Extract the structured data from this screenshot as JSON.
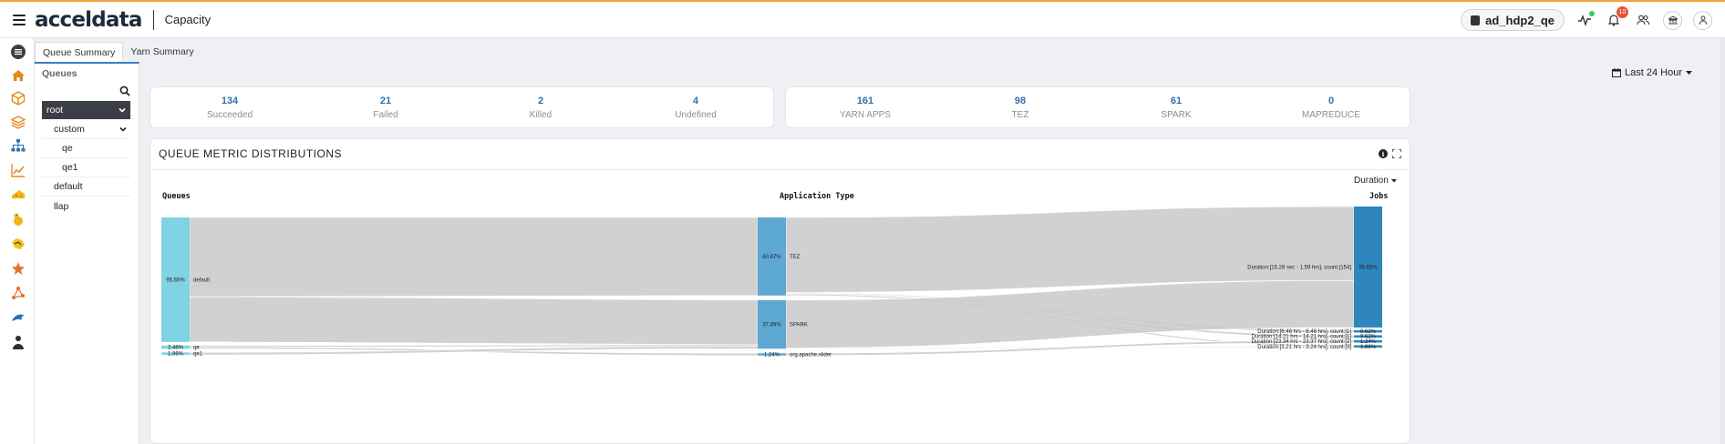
{
  "app": {
    "logo": "acceldata",
    "page_title": "Capacity"
  },
  "topbar": {
    "cluster": "ad_hdp2_qe",
    "notification_count": "10",
    "icons": [
      "pulse-icon",
      "bell-icon",
      "users-icon",
      "bank-icon",
      "user-icon"
    ]
  },
  "rail": {
    "items": [
      "menu-icon",
      "home-icon",
      "cube-icon",
      "layers-icon",
      "sitemap-icon",
      "line-chart-icon",
      "cheese-icon",
      "hadoop-icon",
      "hive-icon",
      "spark-icon",
      "network-icon",
      "dolphin-icon",
      "person-icon"
    ]
  },
  "tabs": [
    {
      "label": "Queue Summary",
      "active": true
    },
    {
      "label": "Yarn Summary",
      "active": false
    }
  ],
  "queues": {
    "title": "Queues",
    "root": "root",
    "items": [
      {
        "label": "custom",
        "expandable": true
      },
      {
        "label": "qe"
      },
      {
        "label": "qe1"
      },
      {
        "label": "default"
      },
      {
        "label": "llap"
      }
    ]
  },
  "date_filter": "Last 24 Hour",
  "stats_left": [
    {
      "value": "134",
      "label": "Succeeded"
    },
    {
      "value": "21",
      "label": "Failed"
    },
    {
      "value": "2",
      "label": "Killed"
    },
    {
      "value": "4",
      "label": "Undefined"
    }
  ],
  "stats_right": [
    {
      "value": "161",
      "label": "YARN APPS"
    },
    {
      "value": "98",
      "label": "TEZ"
    },
    {
      "value": "61",
      "label": "SPARK"
    },
    {
      "value": "0",
      "label": "MAPREDUCE"
    }
  ],
  "metric_panel": {
    "title": "QUEUE METRIC DISTRIBUTIONS",
    "metric_select": "Duration"
  },
  "chart_data": {
    "type": "sankey",
    "columns": [
      "Queues",
      "Application Type",
      "Jobs"
    ],
    "nodes": [
      {
        "name": "default",
        "column": 0,
        "percent": 95.65,
        "pct_label": "95.65%"
      },
      {
        "name": "qe",
        "column": 0,
        "percent": 2.48,
        "pct_label": "2.48%"
      },
      {
        "name": "qe1",
        "column": 0,
        "percent": 1.86,
        "pct_label": "1.86%"
      },
      {
        "name": "TEZ",
        "column": 1,
        "percent": 60.87,
        "pct_label": "60.87%"
      },
      {
        "name": "SPARK",
        "column": 1,
        "percent": 37.89,
        "pct_label": "37.89%"
      },
      {
        "name": "org.apache.slider",
        "column": 1,
        "percent": 1.24,
        "pct_label": "1.24%"
      },
      {
        "name": "Duration:[15.28 sec - 1.59 hrs], count:[154]",
        "column": 2,
        "percent": 95.65,
        "pct_label": "95.65%"
      },
      {
        "name": "Duration:[6.48 hrs - 6.48 hrs], count:[1]",
        "column": 2,
        "percent": 0.62,
        "pct_label": "0.62%"
      },
      {
        "name": "Duration:[14.21 hrs - 14.21 hrs], count:[1]",
        "column": 2,
        "percent": 0.62,
        "pct_label": "0.62%"
      },
      {
        "name": "Duration:[23.34 hrs - 23.37 hrs], count:[2]",
        "column": 2,
        "percent": 1.24,
        "pct_label": "1.24%"
      },
      {
        "name": "Duration:[3.21 hrs - 3.24 hrs], count:[3]",
        "column": 2,
        "percent": 1.86,
        "pct_label": "1.86%"
      }
    ],
    "links": [
      {
        "source": "default",
        "target": "TEZ",
        "value": 60.87
      },
      {
        "source": "default",
        "target": "SPARK",
        "value": 34.78
      },
      {
        "source": "qe",
        "target": "SPARK",
        "value": 1.24
      },
      {
        "source": "qe",
        "target": "org.apache.slider",
        "value": 1.24
      },
      {
        "source": "qe1",
        "target": "SPARK",
        "value": 1.86
      },
      {
        "source": "TEZ",
        "target": "Duration:[15.28 sec - 1.59 hrs], count:[154]",
        "value": 58.39
      },
      {
        "source": "TEZ",
        "target": "Duration:[6.48 hrs - 6.48 hrs], count:[1]",
        "value": 0.62
      },
      {
        "source": "TEZ",
        "target": "Duration:[14.21 hrs - 14.21 hrs], count:[1]",
        "value": 0.62
      },
      {
        "source": "TEZ",
        "target": "Duration:[3.21 hrs - 3.24 hrs], count:[3]",
        "value": 1.24
      },
      {
        "source": "SPARK",
        "target": "Duration:[15.28 sec - 1.59 hrs], count:[154]",
        "value": 37.26
      },
      {
        "source": "SPARK",
        "target": "Duration:[3.21 hrs - 3.24 hrs], count:[3]",
        "value": 0.62
      },
      {
        "source": "org.apache.slider",
        "target": "Duration:[23.34 hrs - 23.37 hrs], count:[2]",
        "value": 1.24
      }
    ]
  }
}
